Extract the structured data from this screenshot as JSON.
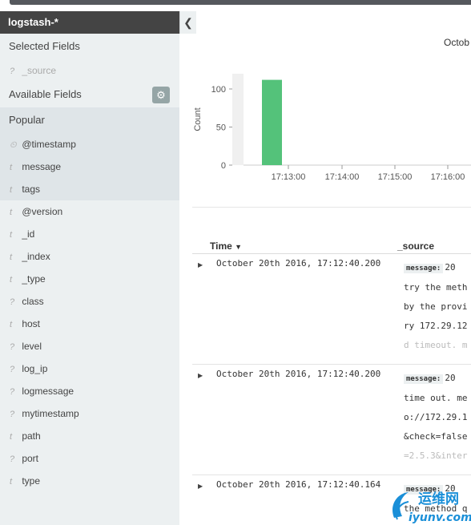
{
  "sidebar": {
    "index_pattern": "logstash-*",
    "selected_title": "Selected Fields",
    "selected_fields": [
      {
        "type": "?",
        "name": "_source"
      }
    ],
    "available_title": "Available Fields",
    "popular_title": "Popular",
    "popular_fields": [
      {
        "type": "⏲",
        "name": "@timestamp"
      },
      {
        "type": "t",
        "name": "message"
      },
      {
        "type": "t",
        "name": "tags"
      }
    ],
    "other_fields": [
      {
        "type": "t",
        "name": "@version"
      },
      {
        "type": "t",
        "name": "_id"
      },
      {
        "type": "t",
        "name": "_index"
      },
      {
        "type": "t",
        "name": "_type"
      },
      {
        "type": "?",
        "name": "class"
      },
      {
        "type": "t",
        "name": "host"
      },
      {
        "type": "?",
        "name": "level"
      },
      {
        "type": "?",
        "name": "log_ip"
      },
      {
        "type": "?",
        "name": "logmessage"
      },
      {
        "type": "?",
        "name": "mytimestamp"
      },
      {
        "type": "t",
        "name": "path"
      },
      {
        "type": "?",
        "name": "port"
      },
      {
        "type": "t",
        "name": "type"
      }
    ],
    "gear_icon": "gear-icon",
    "collapse_icon": "chevron-left-icon"
  },
  "histogram_header": "Octob",
  "chart_data": {
    "type": "bar",
    "ylabel": "Count",
    "ylim": [
      0,
      120
    ],
    "yticks": [
      0,
      50,
      100
    ],
    "categories": [
      "17:12:40"
    ],
    "values": [
      112
    ],
    "xticks": [
      "17:13:00",
      "17:14:00",
      "17:15:00",
      "17:16:00"
    ],
    "bar_color": "#54c27a"
  },
  "table": {
    "time_header": "Time",
    "source_header": "_source",
    "rows": [
      {
        "time": "October 20th 2016, 17:12:40.200",
        "label": "message:",
        "lines": [
          "20",
          "try the meth",
          "by the provi",
          "ry 172.29.12",
          "d timeout. m"
        ]
      },
      {
        "time": "October 20th 2016, 17:12:40.200",
        "label": "message:",
        "lines": [
          "20",
          "time out. me",
          "o://172.29.1",
          "&check=false",
          "=2.5.3&inter"
        ]
      },
      {
        "time": "October 20th 2016, 17:12:40.164",
        "label": "message:",
        "lines": [
          "20",
          "the method q"
        ]
      }
    ]
  },
  "watermark": {
    "brand": "运维网",
    "domain": "iyunv.com"
  }
}
